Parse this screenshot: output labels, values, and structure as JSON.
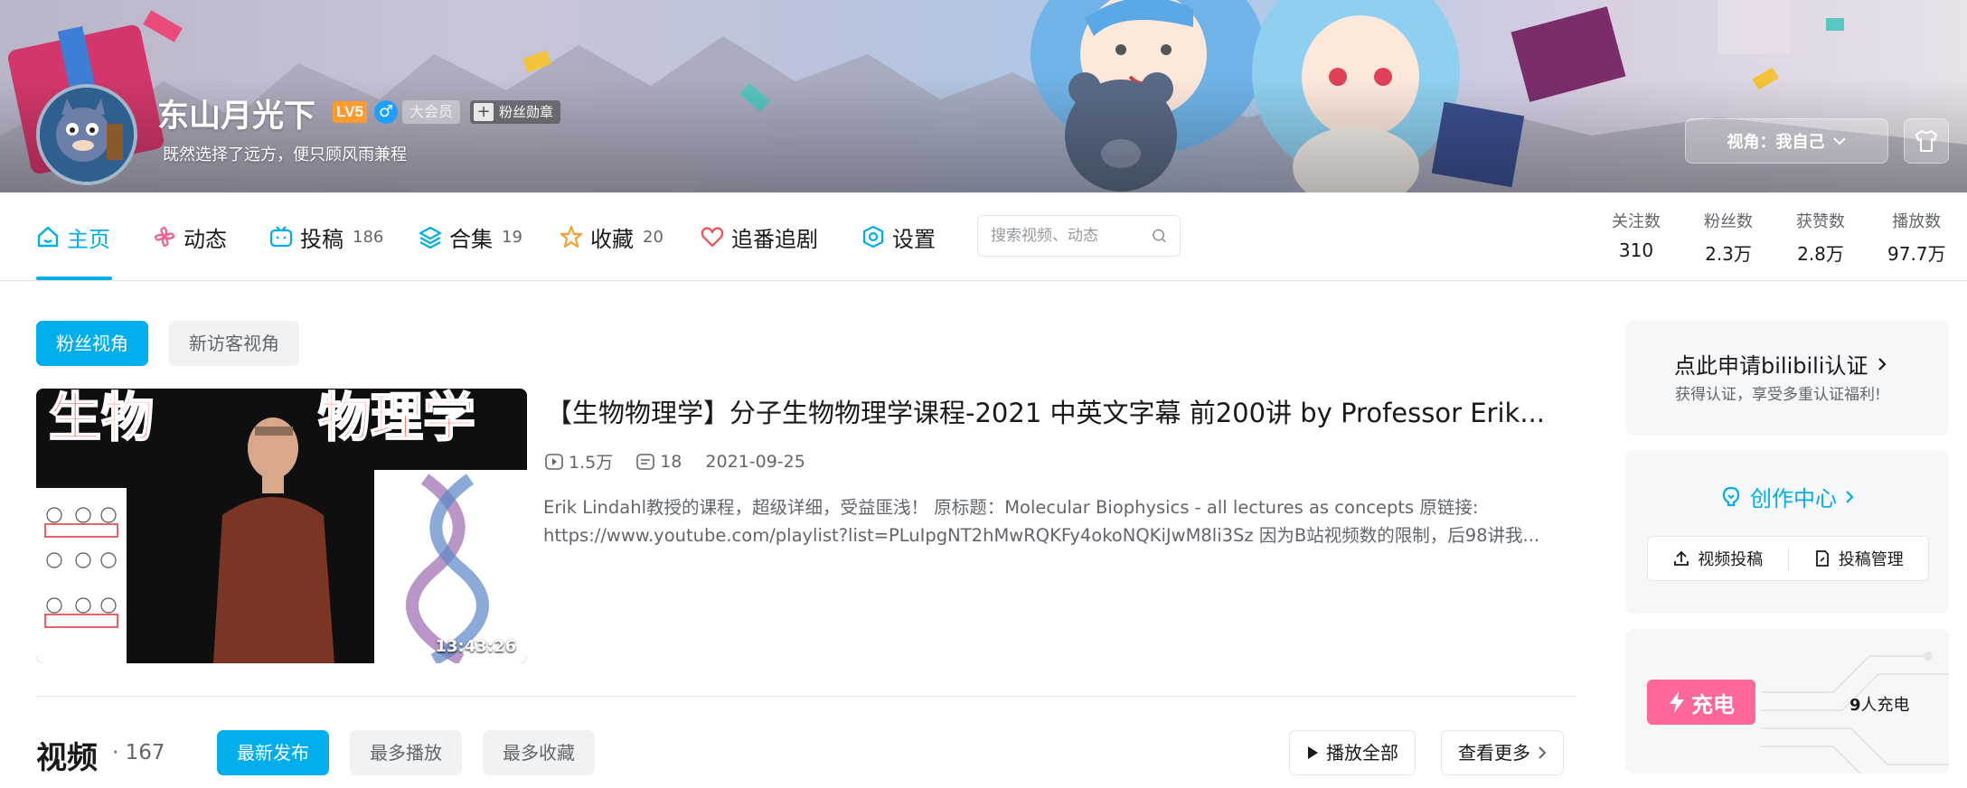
{
  "profile": {
    "name": "东山月光下",
    "level": "LV5",
    "gender": "♂",
    "vip": "大会员",
    "fan_badge": "粉丝勋章",
    "sign": "既然选择了远方，便只顾风雨兼程",
    "view_selector": "视角：我自己"
  },
  "nav": {
    "tabs": [
      {
        "label": "主页",
        "count": "",
        "icon": "home-icon"
      },
      {
        "label": "动态",
        "count": "",
        "icon": "pinwheel-icon"
      },
      {
        "label": "投稿",
        "count": "186",
        "icon": "tv-icon"
      },
      {
        "label": "合集",
        "count": "19",
        "icon": "layers-icon"
      },
      {
        "label": "收藏",
        "count": "20",
        "icon": "star-icon"
      },
      {
        "label": "追番追剧",
        "count": "",
        "icon": "heart-icon"
      },
      {
        "label": "设置",
        "count": "",
        "icon": "settings-icon"
      }
    ],
    "search_placeholder": "搜索视频、动态",
    "stats": [
      {
        "label": "关注数",
        "value": "310"
      },
      {
        "label": "粉丝数",
        "value": "2.3万"
      },
      {
        "label": "获赞数",
        "value": "2.8万"
      },
      {
        "label": "播放数",
        "value": "97.7万"
      }
    ]
  },
  "perspective": {
    "fan": "粉丝视角",
    "visitor": "新访客视角"
  },
  "featured": {
    "title": "【生物物理学】分子生物物理学课程-2021 中英文字幕 前200讲 by Professor Erik...",
    "thumb_left": "生物",
    "thumb_right": "物理学",
    "duration": "13:43:26",
    "plays": "1.5万",
    "danmaku": "18",
    "date": "2021-09-25",
    "desc_line1": "Erik Lindahl教授的课程，超级详细，受益匪浅！ 原标题：Molecular Biophysics - all lectures as concepts 原链接:",
    "desc_line2": "https://www.youtube.com/playlist?list=PLuIpgNT2hMwRQKFy4okoNQKiJwM8li3Sz 因为B站视频数的限制，后98讲我..."
  },
  "videos": {
    "title": "视频",
    "count": "· 167",
    "sort": [
      "最新发布",
      "最多播放",
      "最多收藏"
    ],
    "play_all": "播放全部",
    "more": "查看更多"
  },
  "sidebar": {
    "auth_title": "点此申请bilibili认证",
    "auth_sub": "获得认证，享受多重认证福利!",
    "creator": "创作中心",
    "upload": "视频投稿",
    "manage": "投稿管理",
    "charge": "充电",
    "charge_count": "9",
    "charge_suffix": "人充电"
  },
  "colors": {
    "accent": "#00aeec",
    "pink": "#ff6699",
    "level": "#ff9b2e"
  }
}
